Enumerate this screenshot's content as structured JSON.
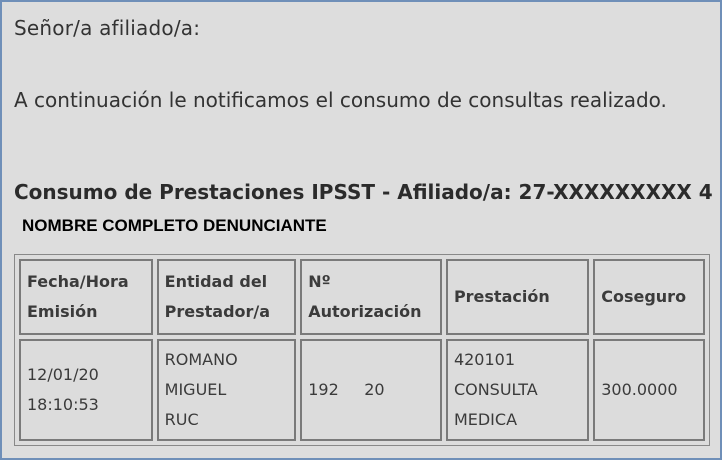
{
  "greeting": "Señor/a afiliado/a:",
  "intro": "A continuación le notificamos el consumo de consultas realizado.",
  "section_title": "Consumo de Prestaciones IPSST - Afiliado/a: 27-XXXXXXXXX 4",
  "denunciante": "NOMBRE COMPLETO DENUNCIANTE",
  "table": {
    "headers": {
      "fecha_l1": "Fecha/Hora",
      "fecha_l2": "Emisión",
      "entidad_l1": "Entidad del",
      "entidad_l2": "Prestador/a",
      "autorizacion_l1": "Nº",
      "autorizacion_l2": "Autorización",
      "prestacion": "Prestación",
      "coseguro": "Coseguro"
    },
    "row": {
      "fecha_l1": "12/01/20",
      "fecha_l2": "18:10:53",
      "entidad_l1": "ROMANO",
      "entidad_l2": "MIGUEL",
      "entidad_l3": "RUC",
      "autorizacion": "192     20",
      "prestacion_l1": "420101",
      "prestacion_l2": "CONSULTA",
      "prestacion_l3": "MEDICA",
      "coseguro": "300.0000"
    }
  }
}
